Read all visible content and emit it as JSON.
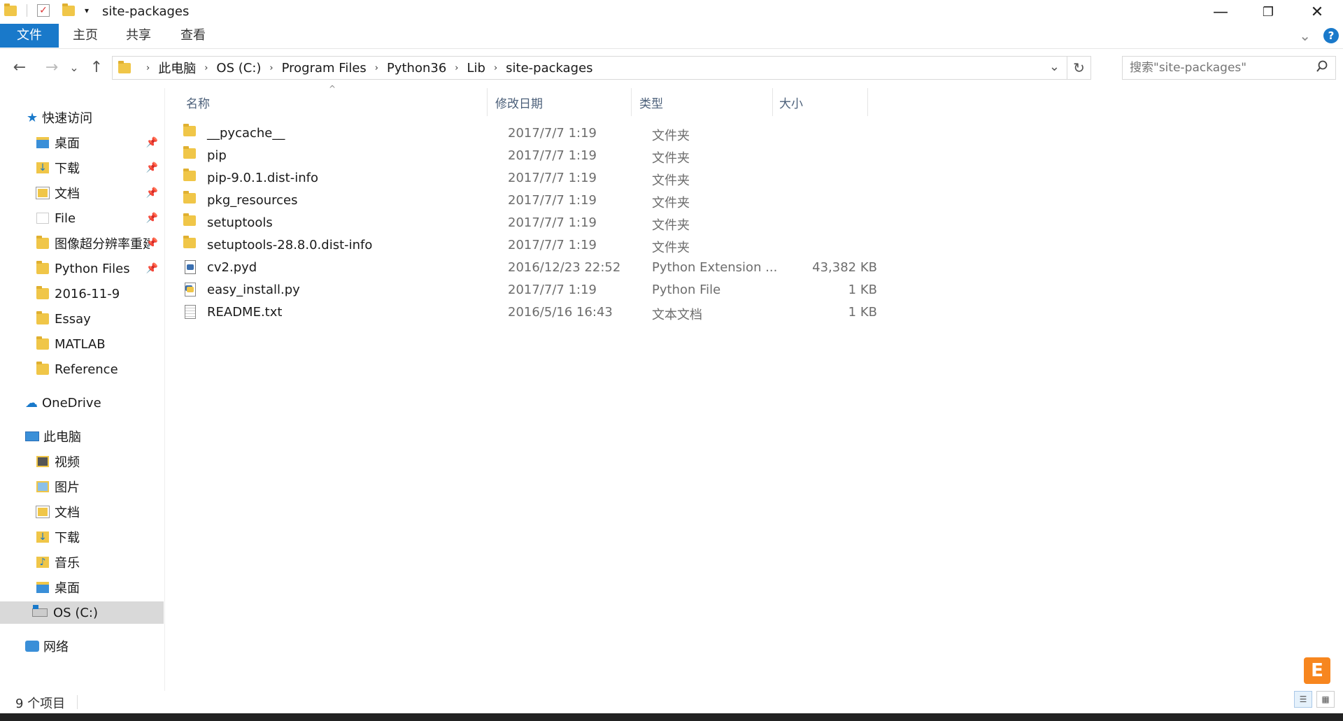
{
  "window": {
    "title": "site-packages",
    "minimize": "—",
    "restore": "❐",
    "close": "✕"
  },
  "ribbon": {
    "tabs": [
      "文件",
      "主页",
      "共享",
      "查看"
    ],
    "expand": "⌄",
    "help": "?"
  },
  "nav": {
    "back": "←",
    "forward": "→",
    "recent": "⌄",
    "up": "↑",
    "breadcrumbs": [
      "此电脑",
      "OS (C:)",
      "Program Files",
      "Python36",
      "Lib",
      "site-packages"
    ],
    "dropdown": "⌄",
    "refresh": "↻",
    "search_placeholder": "搜索\"site-packages\""
  },
  "sidebar": {
    "quick_access": "快速访问",
    "quick_items": [
      {
        "label": "桌面",
        "pinned": true
      },
      {
        "label": "下载",
        "pinned": true
      },
      {
        "label": "文档",
        "pinned": true
      },
      {
        "label": "File",
        "pinned": true
      },
      {
        "label": "图像超分辨率重建",
        "pinned": true
      },
      {
        "label": "Python Files",
        "pinned": true
      },
      {
        "label": "2016-11-9",
        "pinned": false
      },
      {
        "label": "Essay",
        "pinned": false
      },
      {
        "label": "MATLAB",
        "pinned": false
      },
      {
        "label": "Reference",
        "pinned": false
      }
    ],
    "onedrive": "OneDrive",
    "this_pc": "此电脑",
    "pc_items": [
      "视频",
      "图片",
      "文档",
      "下载",
      "音乐",
      "桌面",
      "OS (C:)"
    ],
    "network": "网络"
  },
  "columns": [
    "名称",
    "修改日期",
    "类型",
    "大小"
  ],
  "files": [
    {
      "name": "__pycache__",
      "date": "2017/7/7 1:19",
      "type": "文件夹",
      "size": "",
      "kind": "folder"
    },
    {
      "name": "pip",
      "date": "2017/7/7 1:19",
      "type": "文件夹",
      "size": "",
      "kind": "folder"
    },
    {
      "name": "pip-9.0.1.dist-info",
      "date": "2017/7/7 1:19",
      "type": "文件夹",
      "size": "",
      "kind": "folder"
    },
    {
      "name": "pkg_resources",
      "date": "2017/7/7 1:19",
      "type": "文件夹",
      "size": "",
      "kind": "folder"
    },
    {
      "name": "setuptools",
      "date": "2017/7/7 1:19",
      "type": "文件夹",
      "size": "",
      "kind": "folder"
    },
    {
      "name": "setuptools-28.8.0.dist-info",
      "date": "2017/7/7 1:19",
      "type": "文件夹",
      "size": "",
      "kind": "folder"
    },
    {
      "name": "cv2.pyd",
      "date": "2016/12/23 22:52",
      "type": "Python Extension ...",
      "size": "43,382 KB",
      "kind": "pyd"
    },
    {
      "name": "easy_install.py",
      "date": "2017/7/7 1:19",
      "type": "Python File",
      "size": "1 KB",
      "kind": "py"
    },
    {
      "name": "README.txt",
      "date": "2016/5/16 16:43",
      "type": "文本文档",
      "size": "1 KB",
      "kind": "txt"
    }
  ],
  "status": {
    "count": "9 个项目"
  },
  "badge": "E",
  "colors": {
    "accent": "#1979ca",
    "folder": "#f0c648",
    "selected": "#d9d9d9",
    "header_text": "#4c607a"
  }
}
